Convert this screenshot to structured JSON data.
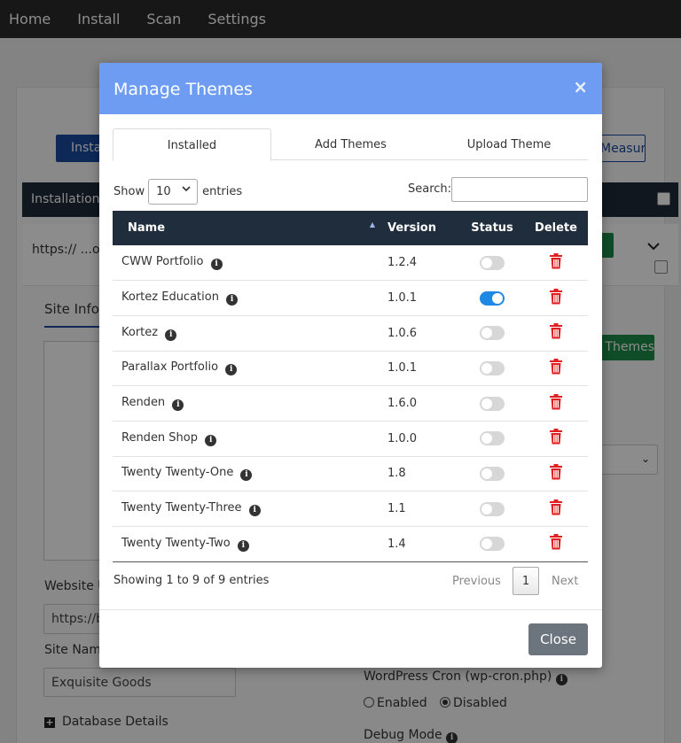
{
  "nav": {
    "items": [
      "Home",
      "Install",
      "Scan",
      "Settings"
    ]
  },
  "background": {
    "install_button": "Install",
    "measures_button": "Measures",
    "installations_header": "Installations",
    "site_url": "https:// ...og",
    "green_button": "Themes",
    "site_info_tab": "Site Info",
    "website_url_label": "Website U",
    "website_url_value": "https://b",
    "site_name_label": "Site Name",
    "site_name_value": "Exquisite Goods",
    "database_details": "Database Details",
    "wp_cron_label": "WordPress Cron (wp-cron.php)",
    "enabled": "Enabled",
    "disabled": "Disabled",
    "debug_mode": "Debug Mode"
  },
  "modal": {
    "title": "Manage Themes",
    "close_icon": "×",
    "tabs": [
      "Installed",
      "Add Themes",
      "Upload Theme"
    ],
    "show_label": "Show",
    "entries_value": "10",
    "entries_label": "entries",
    "search_label": "Search:",
    "search_value": "",
    "columns": {
      "name": "Name",
      "version": "Version",
      "status": "Status",
      "delete": "Delete"
    },
    "rows": [
      {
        "name": "CWW Portfolio",
        "version": "1.2.4",
        "active": false
      },
      {
        "name": "Kortez Education",
        "version": "1.0.1",
        "active": true
      },
      {
        "name": "Kortez",
        "version": "1.0.6",
        "active": false
      },
      {
        "name": "Parallax Portfolio",
        "version": "1.0.1",
        "active": false
      },
      {
        "name": "Renden",
        "version": "1.6.0",
        "active": false
      },
      {
        "name": "Renden Shop",
        "version": "1.0.0",
        "active": false
      },
      {
        "name": "Twenty Twenty-One",
        "version": "1.8",
        "active": false
      },
      {
        "name": "Twenty Twenty-Three",
        "version": "1.1",
        "active": false
      },
      {
        "name": "Twenty Twenty-Two",
        "version": "1.4",
        "active": false
      }
    ],
    "showing_text": "Showing 1 to 9 of 9 entries",
    "previous": "Previous",
    "page": "1",
    "next": "Next",
    "close_button": "Close"
  },
  "colors": {
    "header": "#6d9cf2",
    "table_head": "#1f2d3d",
    "toggle_on": "#1e88e5",
    "trash": "#e02020",
    "close_btn": "#6c757d"
  }
}
